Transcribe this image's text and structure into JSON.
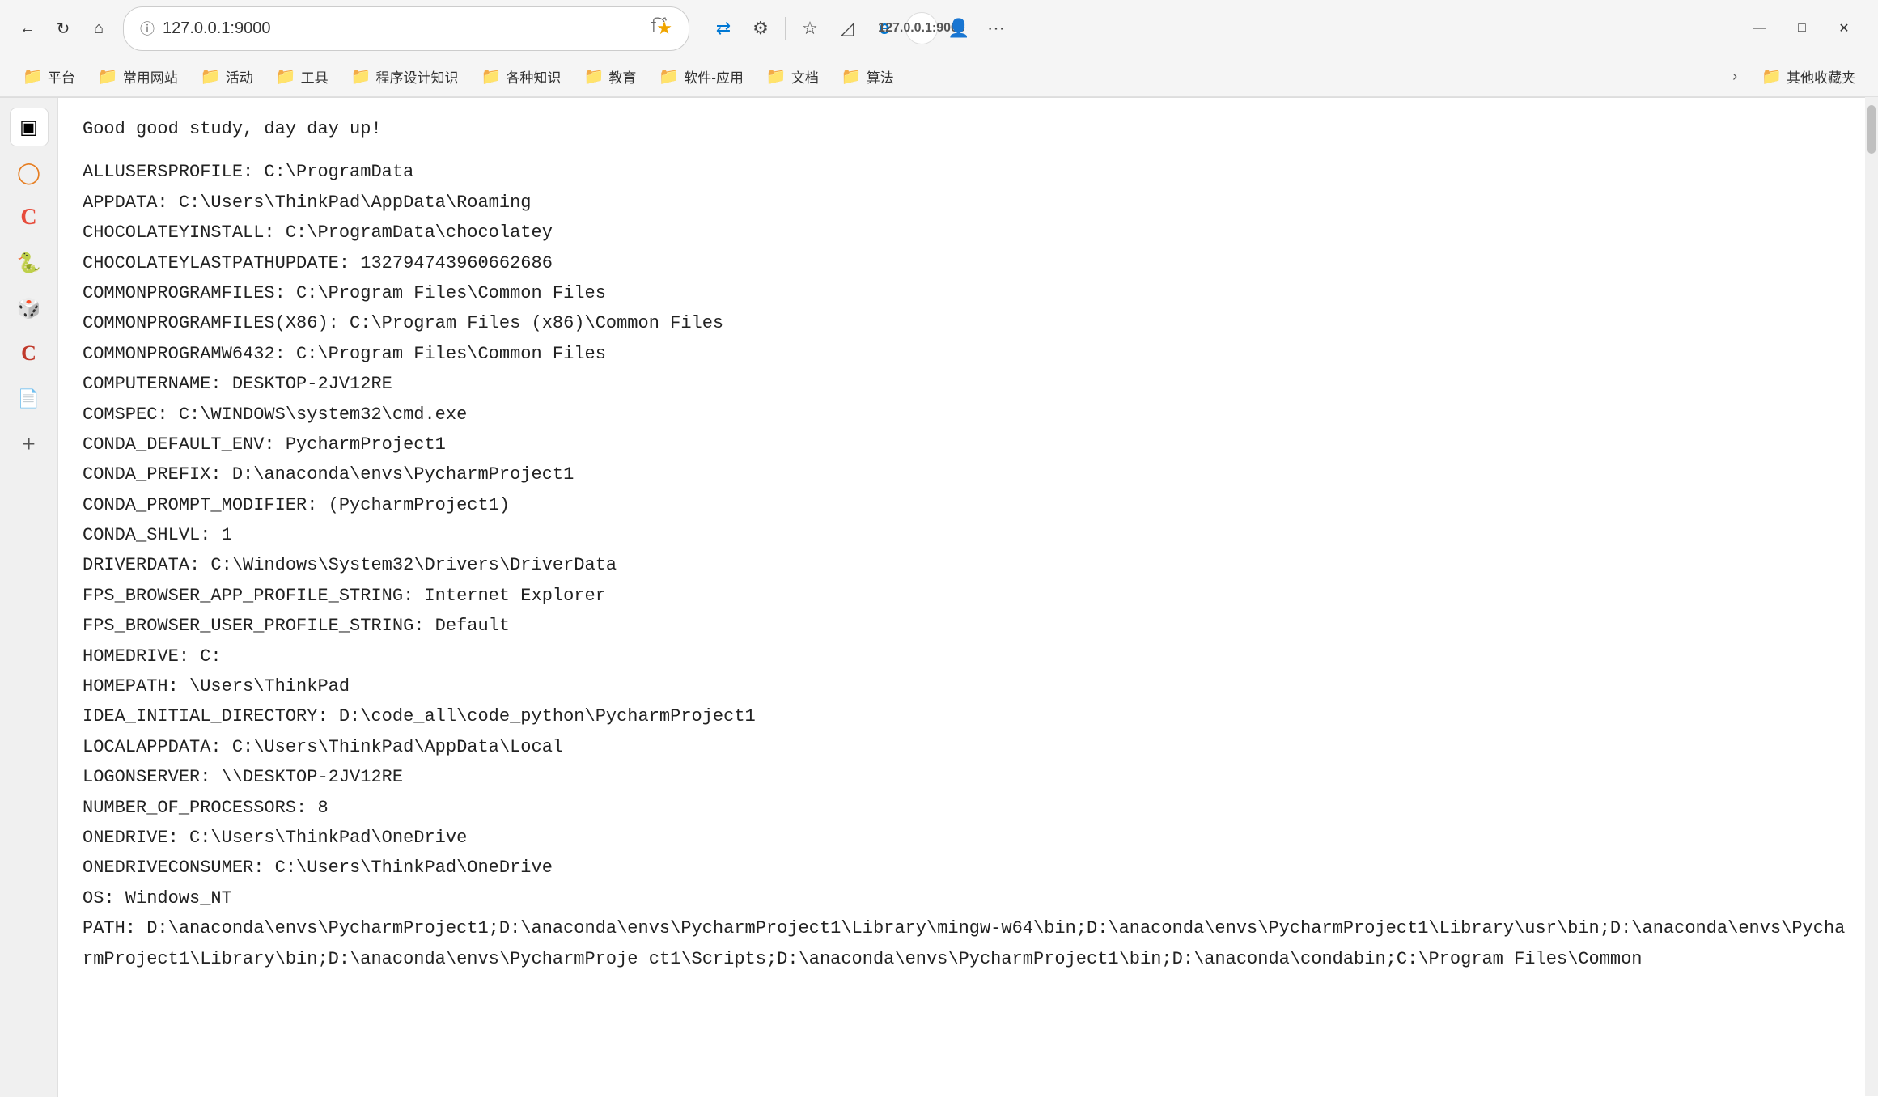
{
  "browser": {
    "address": "127.0.0.1:9000",
    "window_title": "127.0.0.1:9000"
  },
  "bookmarks": {
    "items": [
      {
        "label": "平台",
        "icon": "📁"
      },
      {
        "label": "常用网站",
        "icon": "📁"
      },
      {
        "label": "活动",
        "icon": "📁"
      },
      {
        "label": "工具",
        "icon": "📁"
      },
      {
        "label": "程序设计知识",
        "icon": "📁"
      },
      {
        "label": "各种知识",
        "icon": "📁"
      },
      {
        "label": "教育",
        "icon": "📁"
      },
      {
        "label": "软件-应用",
        "icon": "📁"
      },
      {
        "label": "文档",
        "icon": "📁"
      },
      {
        "label": "算法",
        "icon": "📁"
      }
    ],
    "other_label": "其他收藏夹"
  },
  "content": {
    "greeting": "Good good study, day day up!",
    "lines": [
      "ALLUSERSPROFILE: C:\\ProgramData",
      "APPDATA: C:\\Users\\ThinkPad\\AppData\\Roaming",
      "CHOCOLATEYINSTALL: C:\\ProgramData\\chocolatey",
      "CHOCOLATEYLASTPATHUPDATE: 132794743960662686",
      "COMMONPROGRAMFILES: C:\\Program Files\\Common Files",
      "COMMONPROGRAMFILES(X86): C:\\Program Files (x86)\\Common Files",
      "COMMONPROGRAMW6432: C:\\Program Files\\Common Files",
      "COMPUTERNAME: DESKTOP-2JV12RE",
      "COMSPEC: C:\\WINDOWS\\system32\\cmd.exe",
      "CONDA_DEFAULT_ENV: PycharmProject1",
      "CONDA_PREFIX: D:\\anaconda\\envs\\PycharmProject1",
      "CONDA_PROMPT_MODIFIER: (PycharmProject1)",
      "CONDA_SHLVL: 1",
      "DRIVERDATA: C:\\Windows\\System32\\Drivers\\DriverData",
      "FPS_BROWSER_APP_PROFILE_STRING: Internet Explorer",
      "FPS_BROWSER_USER_PROFILE_STRING: Default",
      "HOMEDRIVE: C:",
      "HOMEPATH: \\Users\\ThinkPad",
      "IDEA_INITIAL_DIRECTORY: D:\\code_all\\code_python\\PycharmProject1",
      "LOCALAPPDATA: C:\\Users\\ThinkPad\\AppData\\Local",
      "LOGONSERVER: \\\\DESKTOP-2JV12RE",
      "NUMBER_OF_PROCESSORS: 8",
      "ONEDRIVE: C:\\Users\\ThinkPad\\OneDrive",
      "ONEDRIVECONSUMER: C:\\Users\\ThinkPad\\OneDrive",
      "OS: Windows_NT",
      "PATH: D:\\anaconda\\envs\\PycharmProject1;D:\\anaconda\\envs\\PycharmProject1\\Library\\mingw-w64\\bin;D:\\anaconda\\envs\\PycharmProject1\\Library\\usr\\bin;D:\\anaconda\\envs\\PycharmProject1\\Library\\bin;D:\\anaconda\\envs\\PycharmProje ct1\\Scripts;D:\\anaconda\\envs\\PycharmProject1\\bin;D:\\anaconda\\condabin;C:\\Program Files\\Common"
    ]
  },
  "sidebar": {
    "icons": [
      {
        "name": "page",
        "label": "Page"
      },
      {
        "name": "extension-orange",
        "label": "Extension Orange"
      },
      {
        "name": "c-red",
        "label": "C Red"
      },
      {
        "name": "python",
        "label": "Python"
      },
      {
        "name": "dice-red",
        "label": "Dice Red"
      },
      {
        "name": "c-dark-red",
        "label": "C Dark Red"
      },
      {
        "name": "document",
        "label": "Document"
      },
      {
        "name": "add",
        "label": "Add"
      }
    ]
  },
  "window_controls": {
    "minimize": "—",
    "maximize": "□",
    "close": "✕"
  }
}
